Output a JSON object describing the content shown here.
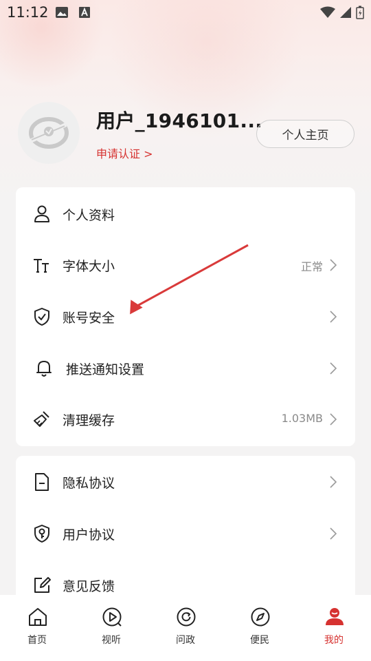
{
  "status_bar": {
    "time": "11:12"
  },
  "profile": {
    "username": "用户_1946101...",
    "certify_link": "申请认证 >",
    "home_button": "个人主页"
  },
  "settings_group1": [
    {
      "label": "个人资料",
      "icon": "person-icon",
      "value": "",
      "chevron": false
    },
    {
      "label": "字体大小",
      "icon": "font-size-icon",
      "value": "正常",
      "chevron": true
    },
    {
      "label": "账号安全",
      "icon": "shield-check-icon",
      "value": "",
      "chevron": true
    },
    {
      "label": "推送通知设置",
      "icon": "bell-icon",
      "value": "",
      "chevron": true
    },
    {
      "label": "清理缓存",
      "icon": "broom-icon",
      "value": "1.03MB",
      "chevron": true
    }
  ],
  "settings_group2": [
    {
      "label": "隐私协议",
      "icon": "document-icon",
      "value": "",
      "chevron": true
    },
    {
      "label": "用户协议",
      "icon": "shield-key-icon",
      "value": "",
      "chevron": true
    },
    {
      "label": "意见反馈",
      "icon": "edit-icon",
      "value": "",
      "chevron": false
    }
  ],
  "bottom_nav": [
    {
      "label": "首页",
      "icon": "home-icon",
      "active": false
    },
    {
      "label": "视听",
      "icon": "play-icon",
      "active": false
    },
    {
      "label": "问政",
      "icon": "refresh-icon",
      "active": false
    },
    {
      "label": "便民",
      "icon": "compass-icon",
      "active": false
    },
    {
      "label": "我的",
      "icon": "user-icon",
      "active": true
    }
  ],
  "colors": {
    "accent": "#d63230",
    "annotation_arrow": "#d93a3a"
  }
}
